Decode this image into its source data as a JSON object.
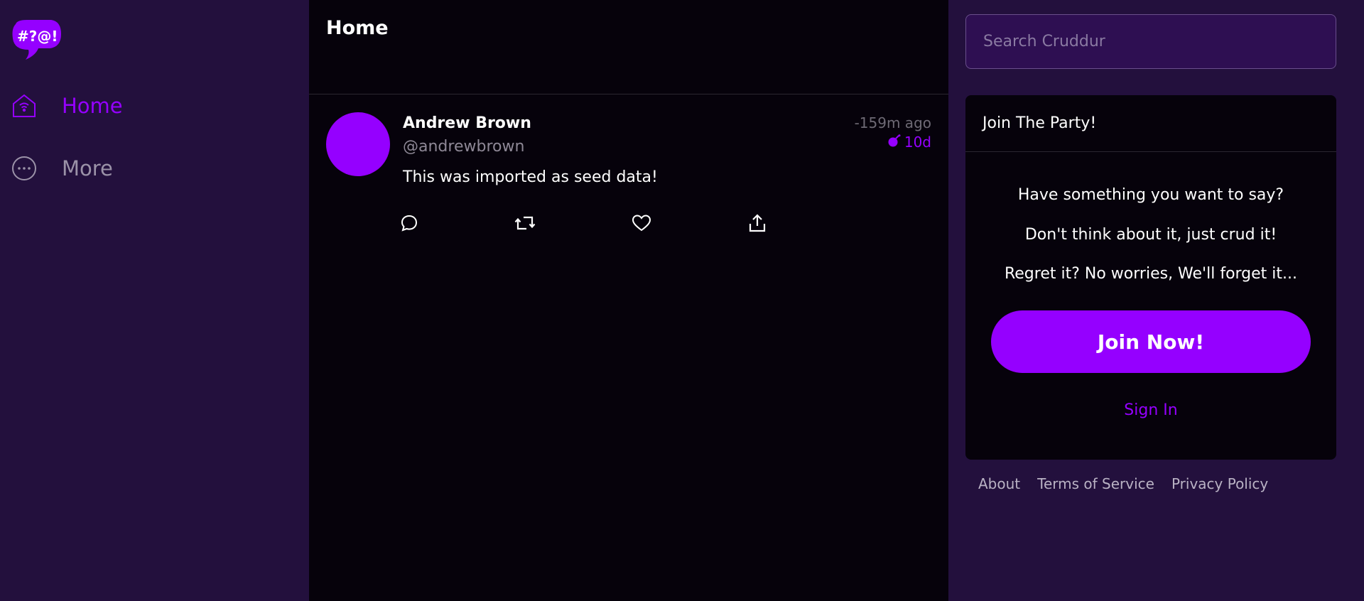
{
  "logo": {
    "text": "#?@!"
  },
  "sidebar": {
    "items": [
      {
        "label": "Home",
        "icon": "home-icon",
        "active": true
      },
      {
        "label": "More",
        "icon": "more-icon",
        "active": false
      }
    ]
  },
  "main": {
    "title": "Home",
    "posts": [
      {
        "name": "Andrew Brown",
        "handle": "@andrewbrown",
        "time": "-159m ago",
        "expires": "10d",
        "body": "This was imported as seed data!"
      }
    ]
  },
  "right": {
    "search_placeholder": "Search Cruddur",
    "card": {
      "title": "Join The Party!",
      "line1": "Have something you want to say?",
      "line2": "Don't think about it, just crud it!",
      "line3": "Regret it? No worries, We'll forget it...",
      "join_label": "Join Now!",
      "signin_label": "Sign In"
    },
    "footer": [
      "About",
      "Terms of Service",
      "Privacy Policy"
    ]
  },
  "colors": {
    "accent": "#9500ff",
    "sidebar_bg": "#23103d",
    "main_bg": "#06020b"
  }
}
